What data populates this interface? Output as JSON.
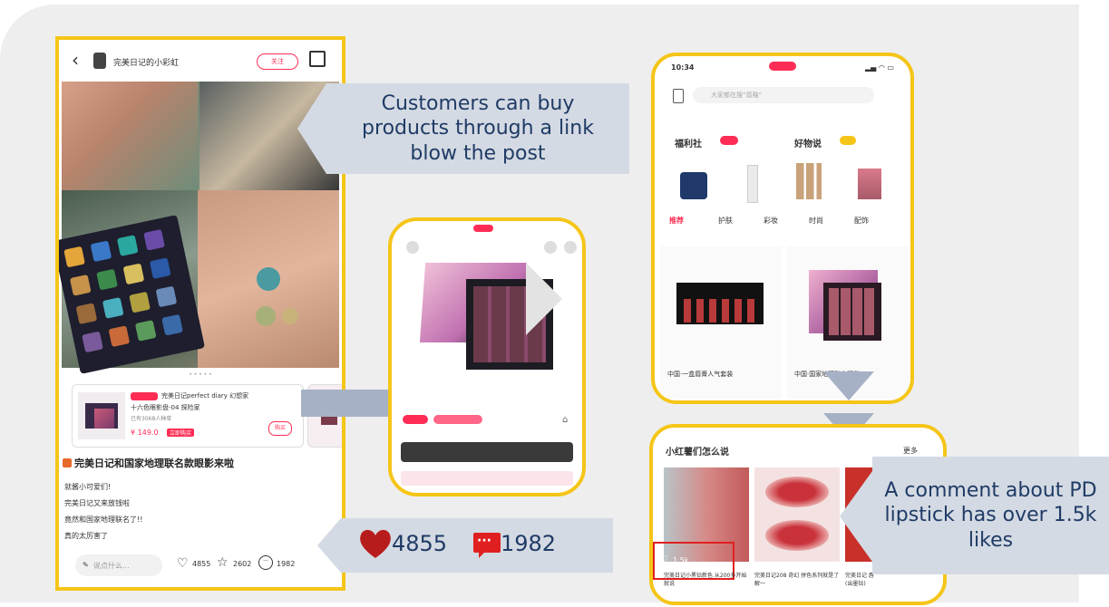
{
  "post": {
    "author": "完美日记的小彩虹",
    "follow_label": "关注",
    "product_title": "完美日记perfect diary 幻想家",
    "product_subtitle": "十六色眼影盘-04 探险家",
    "product_sold": "已有3068人种草",
    "product_price": "¥ 149.0",
    "price_tag": "立即购买",
    "buy_label": "购买",
    "post_title": "完美日记和国家地理联名款眼影来啦",
    "body_lines": [
      "就酱小可爱们!",
      "完美日记又来放钱啦",
      "竟然和国家地理联名了!!",
      "真的太厉害了"
    ],
    "comment_placeholder": "说点什么...",
    "likes_count": "4855",
    "stars_count": "2602",
    "comments_count": "1982"
  },
  "callouts": {
    "buy_link": "Customers can buy products through a link blow the post",
    "comment_lipstick": "A comment about PD lipstick has over 1.5k likes"
  },
  "stats_banner": {
    "likes": "4855",
    "comments": "1982"
  },
  "store": {
    "time": "10:34",
    "search_placeholder": "大家都在搜“唇釉”",
    "section_left": "福利社",
    "section_right": "好物说",
    "tabs": [
      "推荐",
      "护肤",
      "彩妆",
      "时尚",
      "配饰"
    ],
    "item1": "中国·一盒唇膏人气套装",
    "item2": "中国·国家地理联名眼影"
  },
  "community": {
    "title": "小红薯们怎么说",
    "more": "更多",
    "likes": "1.5k",
    "caption1": "完美日记小黑钻新色 从200多开始就说",
    "caption2": "完美日记208 奇幻 拼色系列就是了解一",
    "caption3": "完美日记 唇(出墨钻)"
  },
  "colors": {
    "frame": "#f5c518",
    "callout_bg": "#d4dae3",
    "callout_text": "#1f3b66",
    "heart": "#b71c1c",
    "accent_pink": "#ff2d55"
  }
}
